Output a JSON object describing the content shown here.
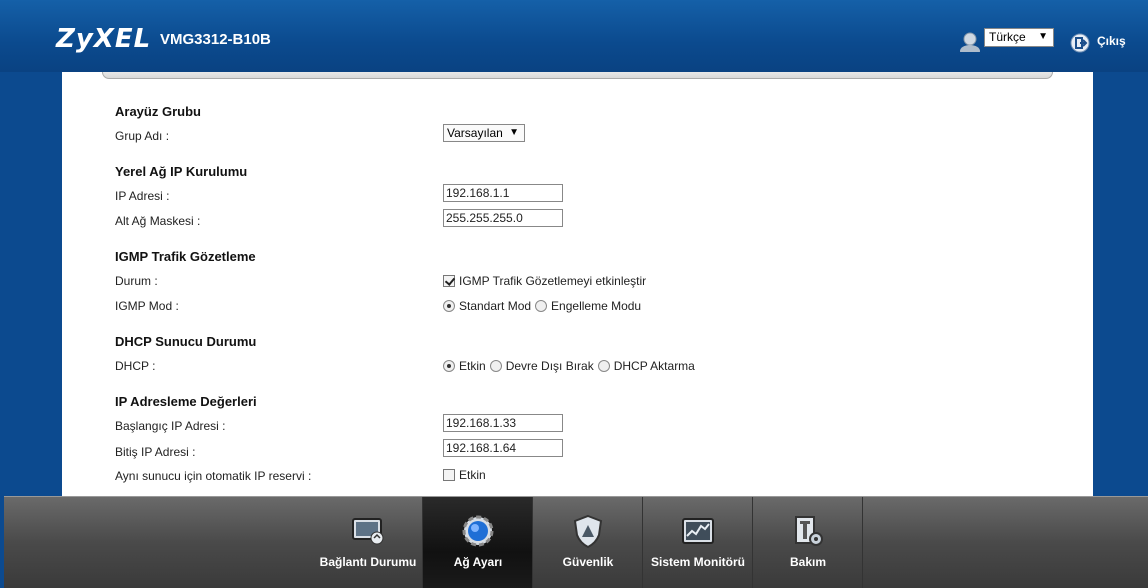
{
  "header": {
    "brand": "ZyXEL",
    "model": "VMG3312-B10B",
    "language": "Türkçe",
    "logout_label": "Çıkış"
  },
  "form": {
    "interface_group": {
      "title": "Arayüz Grubu",
      "group_name_label": "Grup Adı :",
      "group_name_value": "Varsayılan"
    },
    "lan_ip": {
      "title": "Yerel Ağ IP Kurulumu",
      "ip_label": "IP Adresi :",
      "ip_value": "192.168.1.1",
      "subnet_label": "Alt Ağ Maskesi :",
      "subnet_value": "255.255.255.0"
    },
    "igmp": {
      "title": "IGMP Trafik Gözetleme",
      "status_label": "Durum :",
      "status_checkbox_label": "IGMP Trafik Gözetlemeyi etkinleştir",
      "status_checked": true,
      "mode_label": "IGMP Mod :",
      "mode_options": [
        "Standart Mod",
        "Engelleme Modu"
      ],
      "mode_selected": "Standart Mod"
    },
    "dhcp": {
      "title": "DHCP Sunucu Durumu",
      "dhcp_label": "DHCP :",
      "options": [
        "Etkin",
        "Devre Dışı Bırak",
        "DHCP Aktarma"
      ],
      "selected": "Etkin"
    },
    "ip_addressing": {
      "title": "IP Adresleme Değerleri",
      "start_label": "Başlangıç IP Adresi :",
      "start_value": "192.168.1.33",
      "end_label": "Bitiş IP Adresi :",
      "end_value": "192.168.1.64",
      "auto_reserve_label": "Aynı sunucu için otomatik IP reservi :",
      "auto_reserve_checkbox_label": "Etkin",
      "auto_reserve_checked": false
    }
  },
  "nav": {
    "items": [
      {
        "label": "Bağlantı Durumu",
        "icon": "monitor-status-icon",
        "active": false
      },
      {
        "label": "Ağ Ayarı",
        "icon": "network-gear-icon",
        "active": true
      },
      {
        "label": "Güvenlik",
        "icon": "security-shield-icon",
        "active": false
      },
      {
        "label": "Sistem Monitörü",
        "icon": "system-monitor-icon",
        "active": false
      },
      {
        "label": "Bakım",
        "icon": "maintenance-tools-icon",
        "active": false
      }
    ]
  },
  "colors": {
    "header_blue": "#0b4a8e",
    "nav_gray": "#4a4a4a",
    "nav_active": "#111111"
  }
}
